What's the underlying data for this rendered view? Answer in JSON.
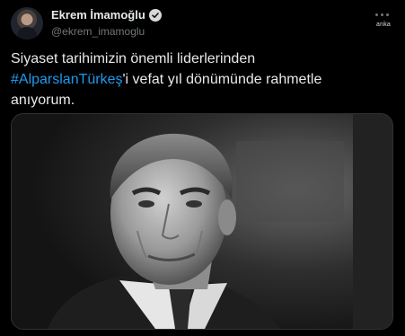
{
  "header": {
    "display_name": "Ekrem İmamoğlu",
    "handle": "@ekrem_imamoglu",
    "watermark": "anka"
  },
  "icons": {
    "verified": "verified-badge-icon",
    "more": "more-options-icon"
  },
  "tweet": {
    "text_line1": "Siyaset tarihimizin önemli liderlerinden",
    "hashtag": "#AlparslanTürkeş",
    "text_after_hashtag": "'i vefat yıl dönümünde rahmetle",
    "text_line3": "anıyorum."
  },
  "media": {
    "type": "black-and-white portrait photo"
  },
  "colors": {
    "background": "#000000",
    "text": "#e7e9ea",
    "secondary_text": "#71767b",
    "hashtag": "#1d9bf0"
  }
}
